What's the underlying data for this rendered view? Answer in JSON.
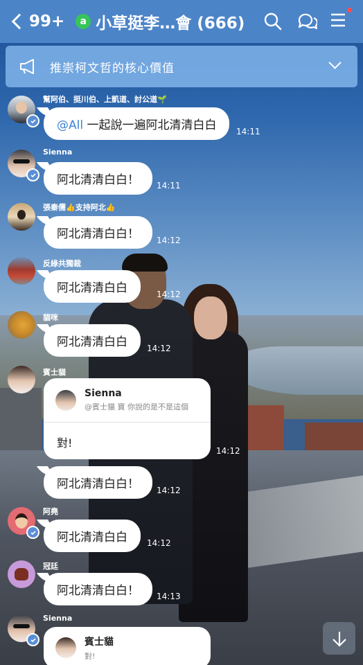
{
  "header": {
    "back_count": "99+",
    "openchat_glyph": "a",
    "title": "小草挺李…會 (666)",
    "icons": [
      "back-chevron-icon",
      "search-icon",
      "chat-bubbles-icon",
      "menu-icon"
    ]
  },
  "announcement": {
    "text": "推崇柯文哲的核心價值",
    "icon": "megaphone-icon"
  },
  "messages": [
    {
      "sender": "幫阿伯、挺川伯、上凱道、討公道🌱",
      "text": "@All 一起說一遍阿北清清白白",
      "mention": "@All",
      "rest": " 一起說一遍阿北清清白白",
      "time": "14:11"
    },
    {
      "sender": "Sienna",
      "text": "阿北清清白白！",
      "time": "14:11"
    },
    {
      "sender": "張秦儒👍支持阿北👍",
      "text": "阿北清清白白！",
      "time": "14:12"
    },
    {
      "sender": "反綠共獨裁",
      "text": "阿北清清白白",
      "time": "14:12"
    },
    {
      "sender": "貓咪",
      "text": "阿北清清白白",
      "time": "14:12"
    },
    {
      "sender": "賓士貓",
      "reply": {
        "quoted_name": "Sienna",
        "quoted_text": "@賓士貓 寶 你說的是不是這個",
        "body": "對!"
      },
      "time": "14:12"
    },
    {
      "sender": "",
      "text": "阿北清清白白！",
      "time": "14:12"
    },
    {
      "sender": "阿堯",
      "text": "阿北清清白白",
      "time": "14:12"
    },
    {
      "sender": "冠廷",
      "text": "阿北清清白白！",
      "time": "14:13"
    },
    {
      "sender": "Sienna",
      "reply": {
        "quoted_name": "賓士貓",
        "quoted_text": "對!"
      }
    }
  ],
  "colors": {
    "header_bg": "#4c84c8",
    "announce_bg": "#76aae2",
    "mention": "#3d82d6",
    "openchat_badge": "#35c559",
    "notification_dot": "#ff4d4d"
  }
}
